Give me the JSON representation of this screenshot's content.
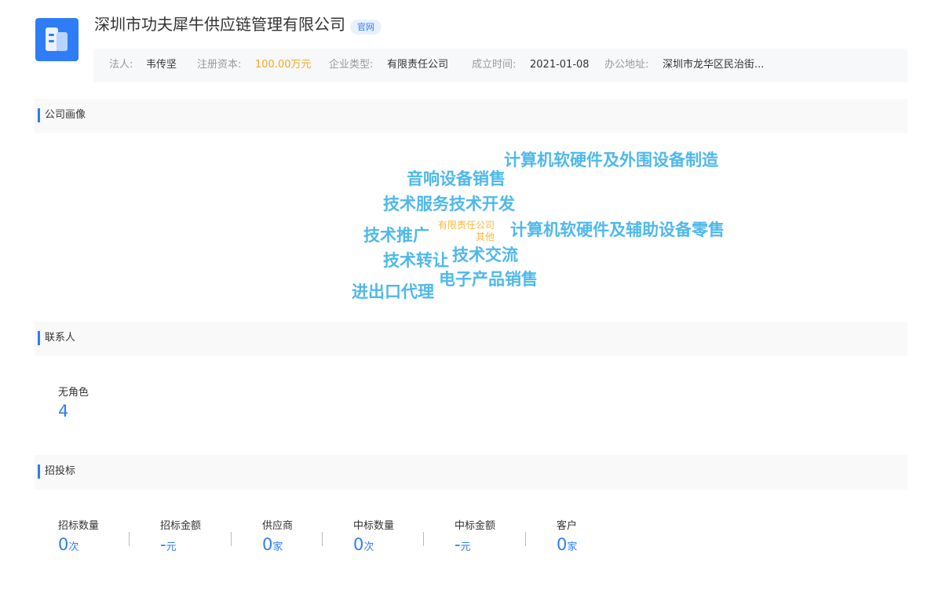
{
  "company": {
    "name": "深圳市功夫犀牛供应链管理有限公司",
    "official_tag": "官网"
  },
  "info": {
    "legal_person_label": "法人:",
    "legal_person": "韦传坚",
    "capital_label": "注册资本:",
    "capital": "100.00万元",
    "type_label": "企业类型:",
    "type": "有限责任公司",
    "founded_label": "成立时间:",
    "founded": "2021-01-08",
    "address_label": "办公地址:",
    "address": "深圳市龙华区民治街..."
  },
  "sections": {
    "profile": "公司画像",
    "contacts": "联系人",
    "bidding": "招投标"
  },
  "word_cloud": [
    "计算机软硬件及外围设备制造",
    "音响设备销售",
    "技术服务技术开发",
    "技术推广",
    "有限责任公司",
    "其他",
    "计算机软硬件及辅助设备零售",
    "技术转让",
    "技术交流",
    "电子产品销售",
    "进出口代理"
  ],
  "contacts": {
    "role_label": "无角色",
    "count": "4"
  },
  "bidding_stats": [
    {
      "label": "招标数量",
      "value": "0",
      "unit": "次"
    },
    {
      "label": "招标金额",
      "value": "-",
      "unit": "元"
    },
    {
      "label": "供应商",
      "value": "0",
      "unit": "家"
    },
    {
      "label": "中标数量",
      "value": "0",
      "unit": "次"
    },
    {
      "label": "中标金额",
      "value": "-",
      "unit": "元"
    },
    {
      "label": "客户",
      "value": "0",
      "unit": "家"
    }
  ],
  "colors": {
    "accent": "#2e7cf6",
    "word_blue": "#4fb8ea",
    "word_orange": "#f5b83d",
    "capital_orange": "#f5a623"
  }
}
